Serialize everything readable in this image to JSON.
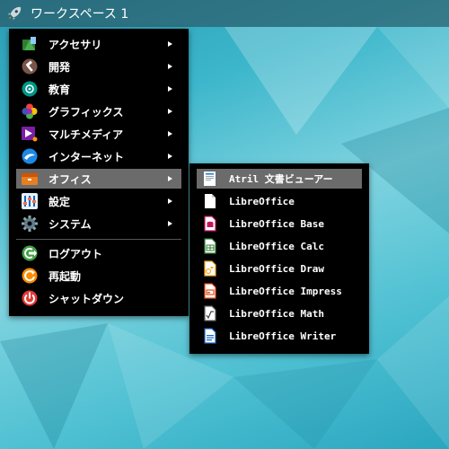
{
  "topbar": {
    "workspace_label": "ワークスペース 1"
  },
  "main_menu": {
    "items": [
      {
        "label": "アクセサリ",
        "icon": "accessories-icon",
        "has_submenu": true
      },
      {
        "label": "開発",
        "icon": "development-icon",
        "has_submenu": true
      },
      {
        "label": "教育",
        "icon": "education-icon",
        "has_submenu": true
      },
      {
        "label": "グラフィックス",
        "icon": "graphics-icon",
        "has_submenu": true
      },
      {
        "label": "マルチメディア",
        "icon": "multimedia-icon",
        "has_submenu": true
      },
      {
        "label": "インターネット",
        "icon": "internet-icon",
        "has_submenu": true
      },
      {
        "label": "オフィス",
        "icon": "office-icon",
        "has_submenu": true,
        "active": true
      },
      {
        "label": "設定",
        "icon": "settings-icon",
        "has_submenu": true
      },
      {
        "label": "システム",
        "icon": "system-icon",
        "has_submenu": true
      }
    ],
    "session_items": [
      {
        "label": "ログアウト",
        "icon": "logout-icon"
      },
      {
        "label": "再起動",
        "icon": "restart-icon"
      },
      {
        "label": "シャットダウン",
        "icon": "shutdown-icon"
      }
    ]
  },
  "office_submenu": {
    "items": [
      {
        "label": "Atril 文書ビューアー",
        "icon": "document-viewer-icon",
        "active": true
      },
      {
        "label": "LibreOffice",
        "icon": "libreoffice-icon"
      },
      {
        "label": "LibreOffice Base",
        "icon": "libreoffice-base-icon"
      },
      {
        "label": "LibreOffice Calc",
        "icon": "libreoffice-calc-icon"
      },
      {
        "label": "LibreOffice Draw",
        "icon": "libreoffice-draw-icon"
      },
      {
        "label": "LibreOffice Impress",
        "icon": "libreoffice-impress-icon"
      },
      {
        "label": "LibreOffice Math",
        "icon": "libreoffice-math-icon"
      },
      {
        "label": "LibreOffice Writer",
        "icon": "libreoffice-writer-icon"
      }
    ]
  },
  "colors": {
    "menu_background": "#000000",
    "active_item": "#6b6b6b",
    "desktop_accent": "#3cb6cb"
  }
}
